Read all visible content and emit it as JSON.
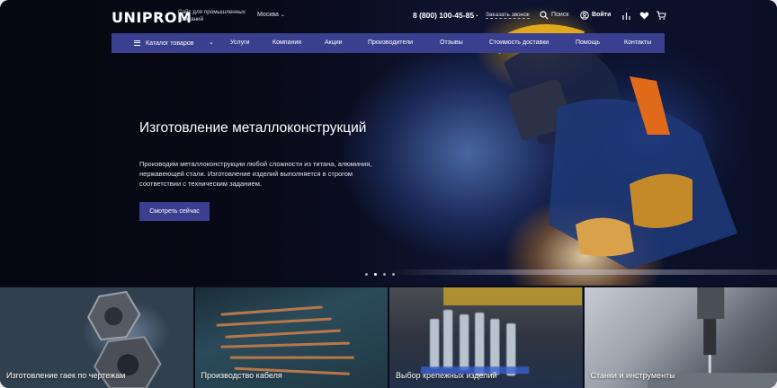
{
  "header": {
    "logo": "UNIPROM",
    "tagline": "Сайт для промышленных компаний",
    "city": "Москва",
    "phone": "8 (800) 100-45-85",
    "callback": "Заказать звонок",
    "search_label": "Поиск",
    "login_label": "Войти"
  },
  "nav": {
    "catalog": "Каталог товаров",
    "items": [
      "Услуги",
      "Компания",
      "Акции",
      "Производители",
      "Отзывы",
      "Стоимость доставки",
      "Помощь",
      "Контакты"
    ]
  },
  "hero": {
    "title": "Изготовление металлоконструкций",
    "text": "Производим металлоконструкции любой сложности из титана, алюминия, нержавеющей стали. Изготовление изделий выполняется в строгом соответствии с техническим заданием.",
    "cta": "Смотреть сейчас",
    "slides_count": 4,
    "active_slide": 2
  },
  "tiles": [
    {
      "label": "Изготовление гаек по чертежам"
    },
    {
      "label": "Производство кабеля"
    },
    {
      "label": "Выбор крепежных изделий"
    },
    {
      "label": "Станки и инструменты"
    }
  ],
  "colors": {
    "accent": "#3b3f90",
    "hero_bg": "#0a0c1a"
  },
  "icons": [
    "search-icon",
    "user-icon",
    "compare-icon",
    "heart-icon",
    "cart-icon",
    "menu-icon",
    "chevron-down-icon"
  ]
}
